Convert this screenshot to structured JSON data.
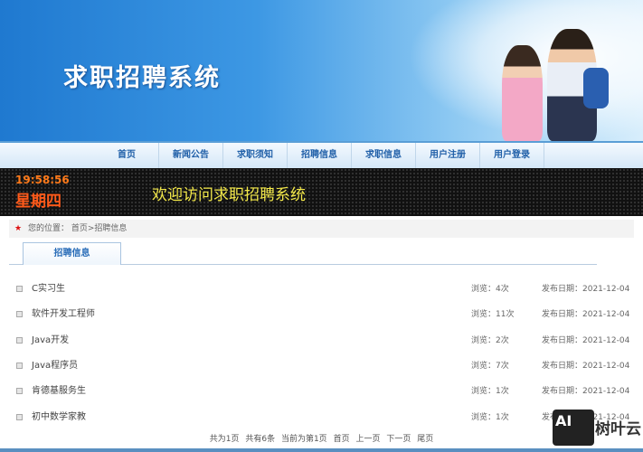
{
  "header": {
    "title": "求职招聘系统"
  },
  "nav": [
    "首页",
    "新闻公告",
    "求职须知",
    "招聘信息",
    "求职信息",
    "用户注册",
    "用户登录"
  ],
  "led": {
    "time": "19:58:56",
    "day": "星期四",
    "welcome": "欢迎访问求职招聘系统"
  },
  "breadcrumb": {
    "label": "您的位置：",
    "path": "首页>招聘信息"
  },
  "tab": "招聘信息",
  "jobs": [
    {
      "title": "C实习生",
      "views": "浏览：4次",
      "date": "发布日期：2021-12-04"
    },
    {
      "title": "软件开发工程师",
      "views": "浏览：11次",
      "date": "发布日期：2021-12-04"
    },
    {
      "title": "Java开发",
      "views": "浏览：2次",
      "date": "发布日期：2021-12-04"
    },
    {
      "title": "Java程序员",
      "views": "浏览：7次",
      "date": "发布日期：2021-12-04"
    },
    {
      "title": "肯德基服务生",
      "views": "浏览：1次",
      "date": "发布日期：2021-12-04"
    },
    {
      "title": "初中数学家教",
      "views": "浏览：1次",
      "date": "发布日期：2021-12-04"
    }
  ],
  "pager": {
    "total_pages": "共为1页",
    "total_items": "共有6条",
    "current": "当前为第1页",
    "first": "首页",
    "prev": "上一页",
    "next": "下一页",
    "last": "尾页"
  },
  "watermark": {
    "logo": "AI",
    "text": "树叶云"
  }
}
